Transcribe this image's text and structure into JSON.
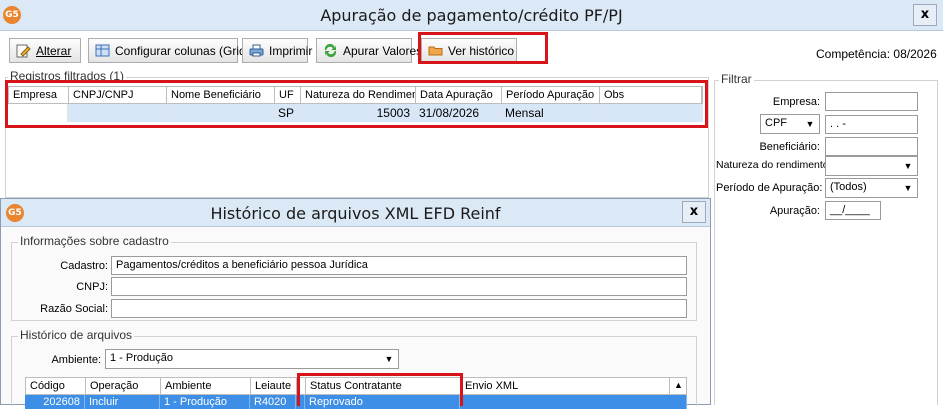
{
  "main_window": {
    "logo": "G5",
    "title": "Apuração de pagamento/crédito PF/PJ",
    "close_label": "x"
  },
  "toolbar": {
    "alterar": "Alterar",
    "configurar": "Configurar colunas (Grid)",
    "imprimir": "Imprimir",
    "apurar": "Apurar Valores",
    "ver_historico": "Ver histórico",
    "competencia_label": "Competência:",
    "competencia_value": "08/2026"
  },
  "registros": {
    "legend": "Registros filtrados (1)",
    "columns": [
      "Empresa",
      "CNPJ/CNPJ",
      "Nome Beneficiário",
      "UF",
      "Natureza do Rendimento",
      "Data Apuração",
      "Período Apuração",
      "Obs"
    ],
    "row": {
      "empresa": "",
      "cnpj": "",
      "nome": "",
      "uf": "SP",
      "natureza": "15003",
      "data": "31/08/2026",
      "periodo": "Mensal",
      "obs": ""
    }
  },
  "filtrar": {
    "legend": "Filtrar",
    "empresa_label": "Empresa:",
    "empresa_value": "",
    "doc_type": "CPF",
    "doc_value": " .   .    -",
    "beneficiario_label": "Beneficiário:",
    "beneficiario_value": "",
    "natureza_label": "Natureza do rendimento:",
    "natureza_value": "",
    "periodo_label": "Período de Apuração:",
    "periodo_value": "(Todos)",
    "apuracao_label": "Apuração:",
    "apuracao_value": "__/____"
  },
  "dialog": {
    "logo": "G5",
    "title": "Histórico de arquivos XML EFD Reinf",
    "close_label": "x",
    "cadastro_group": "Informações sobre cadastro",
    "cadastro_label": "Cadastro:",
    "cadastro_value": "Pagamentos/créditos a beneficiário pessoa Jurídica",
    "cnpj_label": "CNPJ:",
    "cnpj_value": "",
    "razao_label": "Razão Social:",
    "razao_value": "",
    "historico_group": "Histórico de arquivos",
    "ambiente_label": "Ambiente:",
    "ambiente_value": "1 - Produção",
    "columns": [
      "Código",
      "Operação",
      "Ambiente",
      "Leiaute",
      "Status Contratante",
      "Envio XML"
    ],
    "row": {
      "codigo": "202608",
      "operacao": "Incluir",
      "ambiente": "1 - Produção",
      "leiaute": "R4020",
      "status": "Reprovado",
      "envio": ""
    }
  },
  "colors": {
    "highlight": "#d8141b",
    "selected_row": "#d7e7f7",
    "dialog_selected_row": "#3c8ee6",
    "titlebar": "#dbe8f6"
  }
}
